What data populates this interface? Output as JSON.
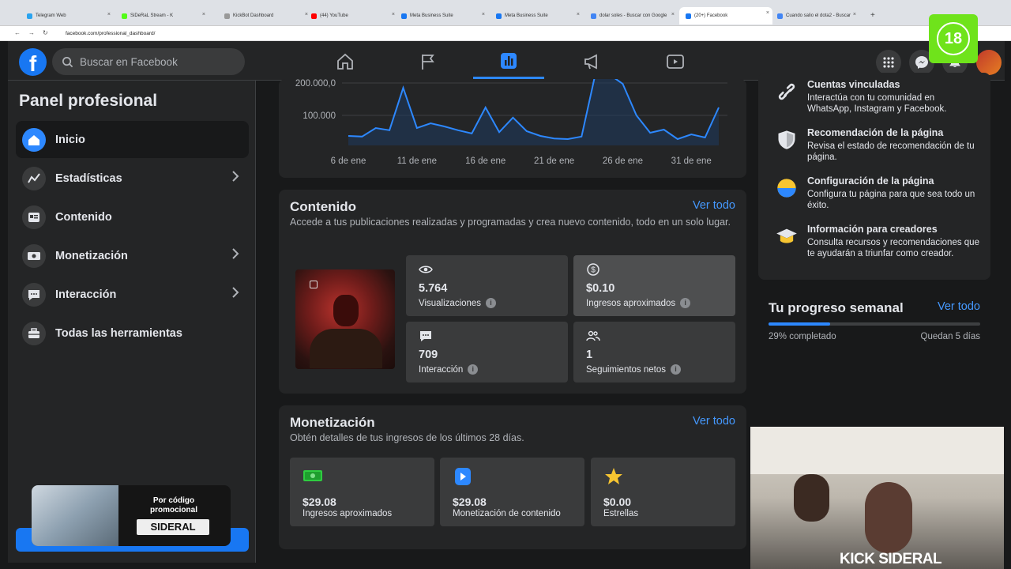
{
  "browser": {
    "tabs": [
      {
        "label": "Telegram Web",
        "color": "#2aa3ef"
      },
      {
        "label": "SiDeRaL Stream - K",
        "color": "#53fc18"
      },
      {
        "label": "KickBot Dashboard",
        "color": "#999999"
      },
      {
        "label": "(44) YouTube",
        "color": "#ff0000"
      },
      {
        "label": "Meta Business Suite",
        "color": "#1877f2"
      },
      {
        "label": "Meta Business Suite",
        "color": "#1877f2"
      },
      {
        "label": "dolar soles - Buscar con Google",
        "color": "#4285f4"
      },
      {
        "label": "(20+) Facebook",
        "color": "#1877f2"
      },
      {
        "label": "Cuando salio el dota2 - Buscar",
        "color": "#4285f4"
      }
    ],
    "new_tab": "+",
    "url": "facebook.com/professional_dashboard/"
  },
  "fb": {
    "logo": "f",
    "search_placeholder": "Buscar en Facebook",
    "nav_icons": [
      "home-icon",
      "flag-icon",
      "dashboard-icon",
      "megaphone-icon",
      "video-icon"
    ]
  },
  "sidebar": {
    "title": "Panel profesional",
    "items": [
      {
        "label": "Inicio",
        "icon": "home-icon",
        "chevron": false
      },
      {
        "label": "Estadísticas",
        "icon": "stats-icon",
        "chevron": true
      },
      {
        "label": "Contenido",
        "icon": "content-icon",
        "chevron": false
      },
      {
        "label": "Monetización",
        "icon": "money-icon",
        "chevron": true
      },
      {
        "label": "Interacción",
        "icon": "chat-icon",
        "chevron": true
      },
      {
        "label": "Todas las herramientas",
        "icon": "toolbox-icon",
        "chevron": false
      }
    ]
  },
  "chart_data": {
    "type": "area",
    "x": [
      "6 de ene",
      "7 de ene",
      "8 de ene",
      "9 de ene",
      "10 de ene",
      "11 de ene",
      "12 de ene",
      "13 de ene",
      "14 de ene",
      "15 de ene",
      "16 de ene",
      "17 de ene",
      "18 de ene",
      "19 de ene",
      "20 de ene",
      "21 de ene",
      "22 de ene",
      "23 de ene",
      "24 de ene",
      "25 de ene",
      "26 de ene",
      "27 de ene",
      "28 de ene",
      "29 de ene",
      "30 de ene",
      "31 de ene",
      "1 de feb",
      "2 de feb"
    ],
    "tick_labels": [
      "6 de ene",
      "11 de ene",
      "16 de ene",
      "21 de ene",
      "26 de ene",
      "31 de ene"
    ],
    "y_tick_labels": [
      "200.000,0",
      "100.000"
    ],
    "values": [
      30000,
      28000,
      55000,
      48000,
      182000,
      55000,
      70000,
      60000,
      48000,
      38000,
      120000,
      42000,
      88000,
      45000,
      30000,
      22000,
      20000,
      28000,
      260000,
      250000,
      195000,
      95000,
      40000,
      50000,
      20000,
      35000,
      25000,
      120000
    ],
    "ylim": [
      0,
      220000
    ],
    "grid": true,
    "color": "#2d88ff"
  },
  "content": {
    "title": "Contenido",
    "see_all": "Ver todo",
    "description": "Accede a tus publicaciones realizadas y programadas y crea nuevo contenido, todo en un solo lugar.",
    "stats": [
      {
        "icon": "eye-icon",
        "value": "5.764",
        "label": "Visualizaciones"
      },
      {
        "icon": "dollar-icon",
        "value": "$0.10",
        "label": "Ingresos aproximados"
      },
      {
        "icon": "chat-icon",
        "value": "709",
        "label": "Interacción"
      },
      {
        "icon": "people-icon",
        "value": "1",
        "label": "Seguimientos netos"
      }
    ]
  },
  "monetization": {
    "title": "Monetización",
    "see_all": "Ver todo",
    "description": "Obtén detalles de tus ingresos de los últimos 28 días.",
    "cards": [
      {
        "icon": "cash-icon",
        "value": "$29.08",
        "label": "Ingresos aproximados"
      },
      {
        "icon": "play-icon",
        "value": "$29.08",
        "label": "Monetización de contenido"
      },
      {
        "icon": "star-icon",
        "value": "$0.00",
        "label": "Estrellas"
      }
    ]
  },
  "right": {
    "items": [
      {
        "icon": "link-icon",
        "title": "Cuentas vinculadas",
        "desc": "Interactúa con tu comunidad en WhatsApp, Instagram y Facebook."
      },
      {
        "icon": "shield-icon",
        "title": "Recomendación de la página",
        "desc": "Revisa el estado de recomendación de tu página."
      },
      {
        "icon": "settings-icon",
        "title": "Configuración de la página",
        "desc": "Configura tu página para que sea todo un éxito."
      },
      {
        "icon": "graduation-icon",
        "title": "Información para creadores",
        "desc": "Consulta recursos y recomendaciones que te ayudarán a triunfar como creador."
      }
    ],
    "progress": {
      "title": "Tu progreso semanal",
      "see_all": "Ver todo",
      "value": 0.29,
      "completed": "29% completado",
      "remaining": "Quedan 5 días"
    }
  },
  "overlays": {
    "promo_line1": "Por código",
    "promo_line2": "promocional",
    "promo_code": "SIDERAL",
    "age_badge": "18",
    "kick_brand": "KICK SIDERAL"
  }
}
